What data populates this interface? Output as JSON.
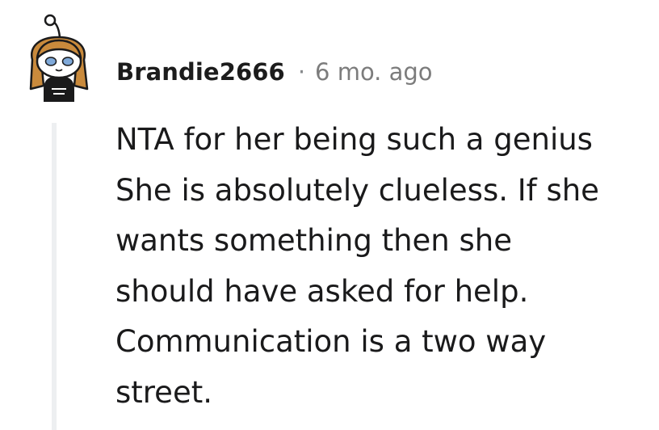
{
  "comment": {
    "username": "Brandie2666",
    "separator": "·",
    "timestamp": "6 mo. ago",
    "lines": [
      "NTA for her being such a genius",
      "She is absolutely clueless. If she",
      "wants something then she",
      "should have asked for help.",
      "Communication is a two way",
      "street."
    ]
  },
  "colors": {
    "text": "#1a1a1b",
    "meta": "#7c7c7c",
    "thread_line": "#edeff1",
    "avatar_hair": "#c98a3c",
    "avatar_eyes": "#7fa9d9"
  }
}
